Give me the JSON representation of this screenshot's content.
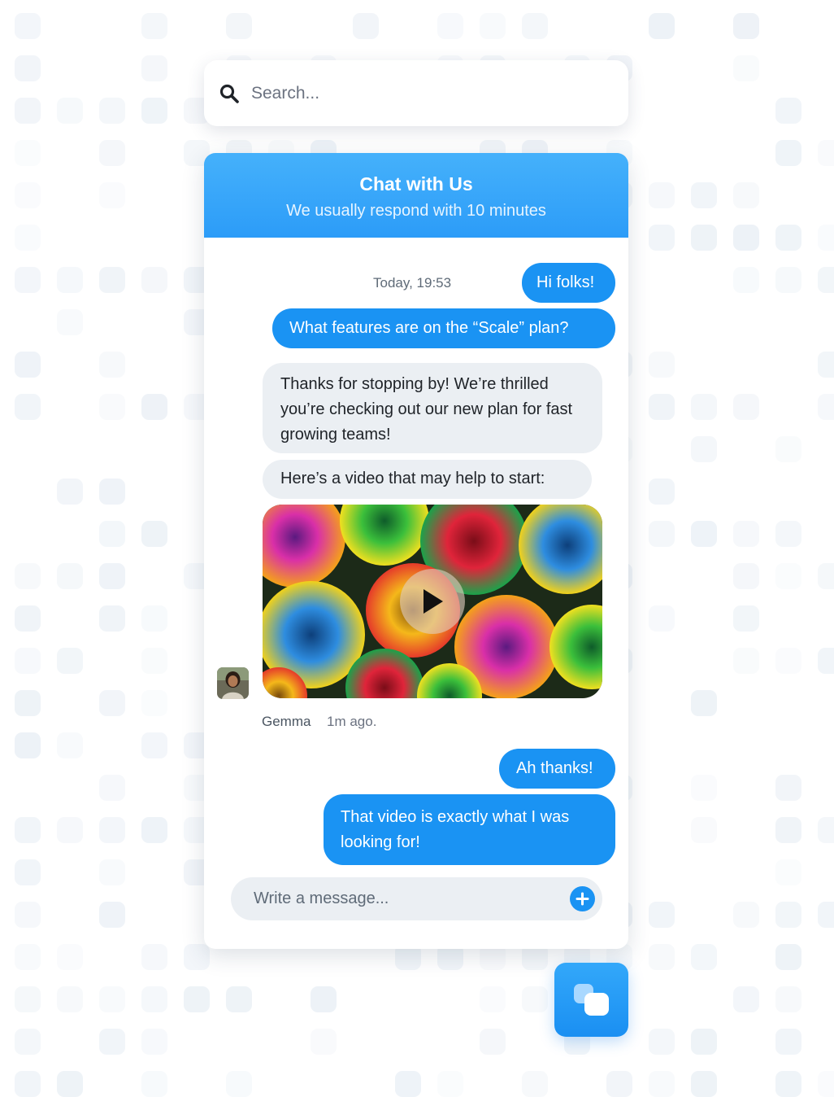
{
  "colors": {
    "accent": "#1a93f3",
    "header_gradient_top": "#45b1fb",
    "incoming_bubble": "#ebeff3",
    "background_tile": "#edf2f7"
  },
  "search": {
    "icon": "search-icon",
    "placeholder": "Search..."
  },
  "chat": {
    "title": "Chat with Us",
    "subtitle": "We usually respond with 10 minutes",
    "timestamp": "Today, 19:53",
    "messages": [
      {
        "from": "user",
        "text": "Hi folks!"
      },
      {
        "from": "user",
        "text": "What features are on the “Scale” plan?"
      },
      {
        "from": "agent",
        "text": "Thanks for stopping by! We’re thrilled you’re checking out our new plan for fast growing teams!"
      },
      {
        "from": "agent",
        "text": "Here’s a video that may help to start:"
      },
      {
        "from": "user",
        "text": "Ah thanks!"
      },
      {
        "from": "user",
        "text": "That video is exactly what I was looking for!"
      }
    ],
    "video": {
      "thumbnail": "rainbow-roses",
      "icon": "play-icon"
    },
    "sender": {
      "name": "Gemma",
      "time": "1m ago."
    },
    "composer": {
      "placeholder": "Write a message...",
      "icon": "plus-icon"
    }
  },
  "launcher": {
    "icon": "chat-bubbles-icon"
  }
}
